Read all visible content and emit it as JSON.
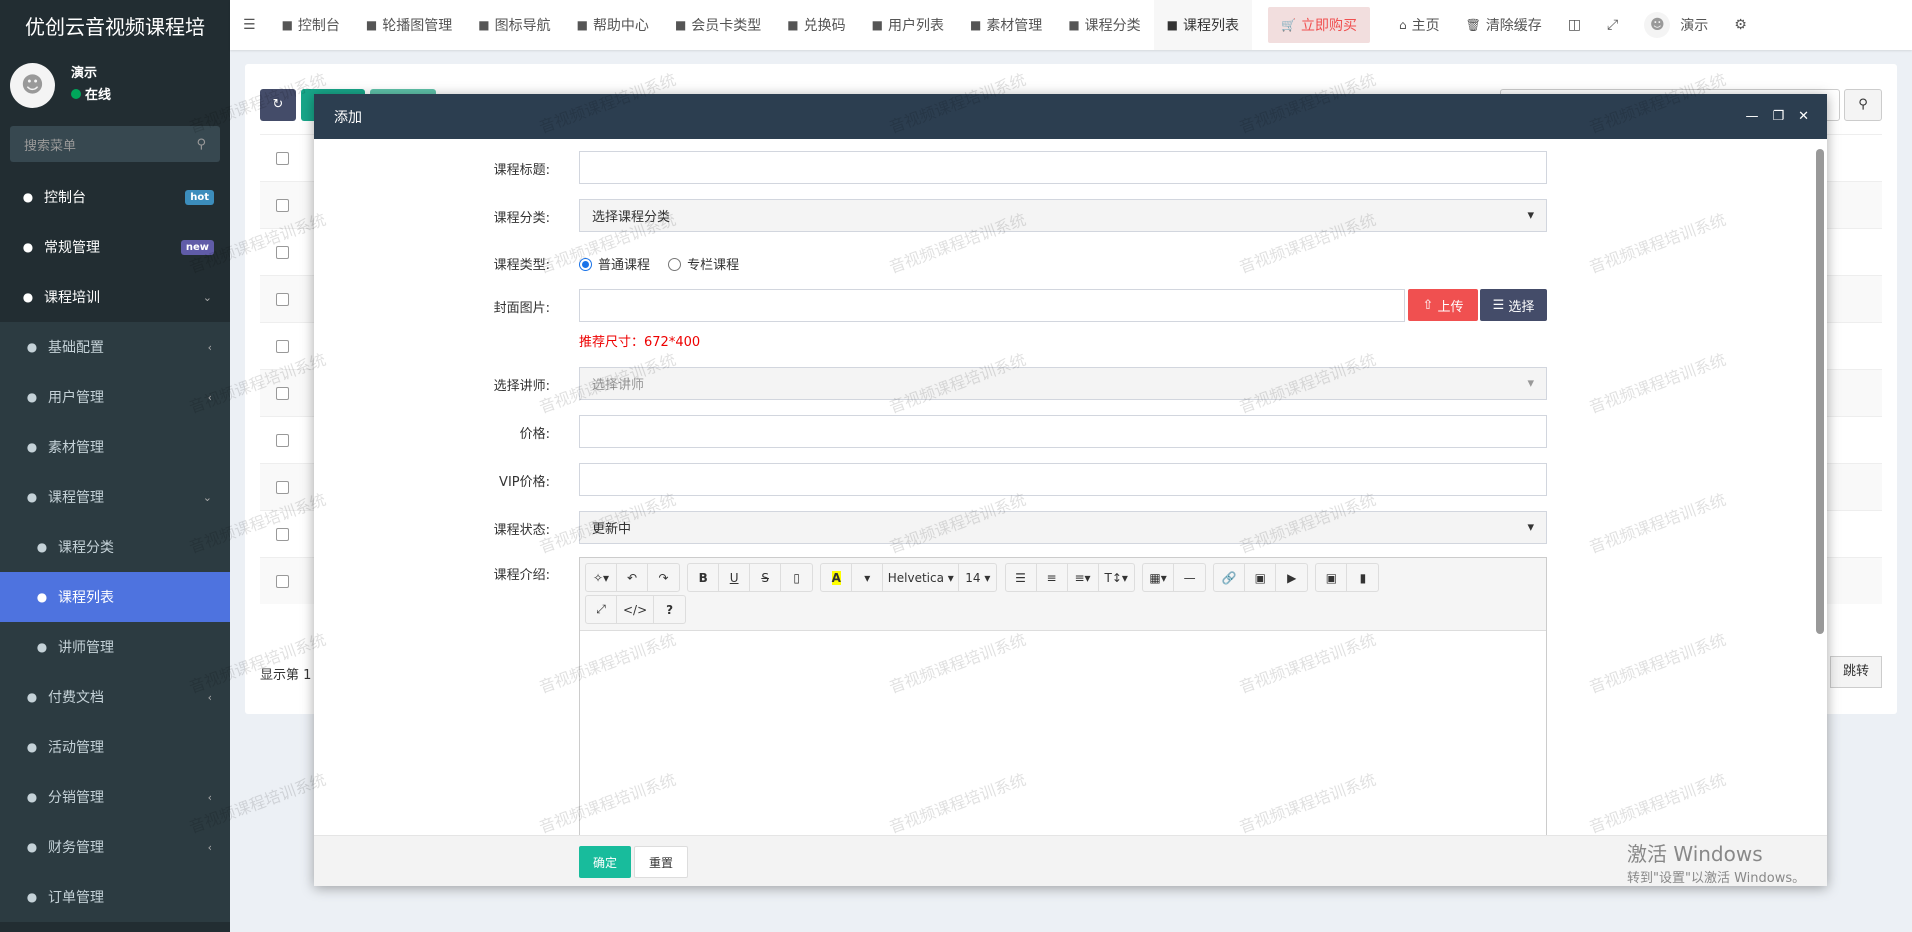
{
  "app_title": "优创云音视频课程培",
  "user": {
    "name": "演示",
    "status": "在线"
  },
  "sidebar": {
    "search_placeholder": "搜索菜单",
    "items": [
      {
        "label": "控制台",
        "icon": "dashboard-icon",
        "badge": "hot",
        "badge_color": "#3c8dbc",
        "type": "top"
      },
      {
        "label": "常规管理",
        "icon": "cogs-icon",
        "badge": "new",
        "badge_color": "#605ca8",
        "type": "top"
      },
      {
        "label": "课程培训",
        "icon": "course-icon",
        "chev": "⌄",
        "type": "top"
      },
      {
        "label": "基础配置",
        "icon": "gear-icon",
        "chev": "‹",
        "type": "sub"
      },
      {
        "label": "用户管理",
        "icon": "user-icon",
        "chev": "‹",
        "type": "sub"
      },
      {
        "label": "素材管理",
        "icon": "cubes-icon",
        "type": "sub"
      },
      {
        "label": "课程管理",
        "icon": "book-icon",
        "chev": "⌄",
        "type": "sub"
      },
      {
        "label": "课程分类",
        "icon": "list-icon",
        "type": "sub2"
      },
      {
        "label": "课程列表",
        "icon": "list-alt-icon",
        "type": "sub2",
        "active": true
      },
      {
        "label": "讲师管理",
        "icon": "user-circle-icon",
        "type": "sub2"
      },
      {
        "label": "付费文档",
        "icon": "file-icon",
        "chev": "‹",
        "type": "sub"
      },
      {
        "label": "活动管理",
        "icon": "activity-icon",
        "type": "sub"
      },
      {
        "label": "分销管理",
        "icon": "card-icon",
        "chev": "‹",
        "type": "sub"
      },
      {
        "label": "财务管理",
        "icon": "yen-icon",
        "chev": "‹",
        "type": "sub"
      },
      {
        "label": "订单管理",
        "icon": "chart-icon",
        "type": "sub"
      }
    ]
  },
  "topnav": {
    "tabs": [
      {
        "label": "控制台",
        "icon": "dashboard-icon"
      },
      {
        "label": "轮播图管理",
        "icon": "image-icon"
      },
      {
        "label": "图标导航",
        "icon": "compass-icon"
      },
      {
        "label": "帮助中心",
        "icon": "file-icon"
      },
      {
        "label": "会员卡类型",
        "icon": "id-card-icon"
      },
      {
        "label": "兑换码",
        "icon": "font-icon"
      },
      {
        "label": "用户列表",
        "icon": "user-icon"
      },
      {
        "label": "素材管理",
        "icon": "cubes-icon"
      },
      {
        "label": "课程分类",
        "icon": "list-icon"
      },
      {
        "label": "课程列表",
        "icon": "list-alt-icon",
        "active": true
      }
    ],
    "buy": "立即购买",
    "home": "主页",
    "clear_cache": "清除缓存",
    "username": "演示"
  },
  "list": {
    "footer_text": "显示第 1",
    "jump": "跳转"
  },
  "modal": {
    "title": "添加",
    "fields": {
      "title_label": "课程标题:",
      "category_label": "课程分类:",
      "category_value": "选择课程分类",
      "type_label": "课程类型:",
      "type_options": [
        "普通课程",
        "专栏课程"
      ],
      "cover_label": "封面图片:",
      "upload": "上传",
      "choose": "选择",
      "cover_hint": "推荐尺寸：672*400",
      "teacher_label": "选择讲师:",
      "teacher_value": "选择讲师",
      "price_label": "价格:",
      "vip_label": "VIP价格:",
      "status_label": "课程状态:",
      "status_value": "更新中",
      "intro_label": "课程介绍:"
    },
    "editor": {
      "font": "Helvetica",
      "size": "14"
    },
    "confirm": "确定",
    "reset": "重置"
  },
  "watermark": "音视频课程培训系统",
  "windows": {
    "line1": "激活 Windows",
    "line2": "转到\"设置\"以激活 Windows。"
  }
}
